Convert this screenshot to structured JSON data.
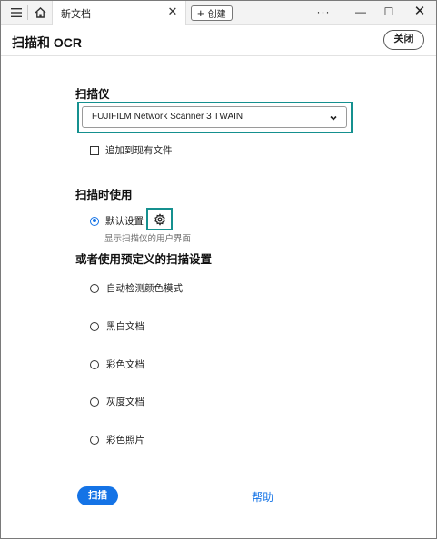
{
  "tabbar": {
    "tab_title": "新文档",
    "create_label": "创建",
    "more": "···",
    "minimize": "—",
    "maximize": "☐",
    "close": "✕"
  },
  "dialog": {
    "title": "扫描和 OCR",
    "close_label": "关闭"
  },
  "scanner": {
    "section_label": "扫描仪",
    "selected": "FUJIFILM Network Scanner 3 TWAIN",
    "append_label": "追加到现有文件",
    "append_checked": false
  },
  "use_when_scanning": {
    "section_label": "扫描时使用",
    "default_label": "默认设置",
    "default_selected": true,
    "hint": "显示扫描仪的用户界面"
  },
  "presets": {
    "section_label": "或者使用预定义的扫描设置",
    "items": [
      {
        "label": "自动检测颜色模式"
      },
      {
        "label": "黑白文档"
      },
      {
        "label": "彩色文档"
      },
      {
        "label": "灰度文档"
      },
      {
        "label": "彩色照片"
      }
    ]
  },
  "footer": {
    "scan_label": "扫描",
    "help_label": "帮助"
  },
  "colors": {
    "accent": "#1473e6",
    "highlight": "#15908f"
  },
  "icons": {
    "menu": "hamburger-icon",
    "home": "home-icon",
    "settings": "gear-icon",
    "dropdown": "chevron-down-icon"
  }
}
